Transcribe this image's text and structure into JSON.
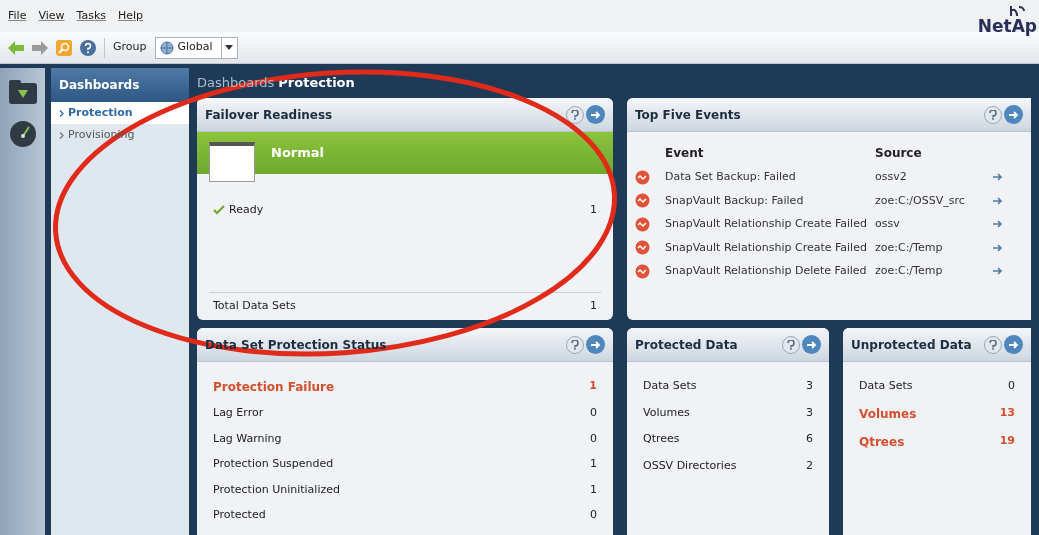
{
  "menu": [
    "File",
    "View",
    "Tasks",
    "Help"
  ],
  "toolbar": {
    "group_label": "Group",
    "group_value": "Global"
  },
  "logo": "NetAp",
  "nav": {
    "title": "Dashboards",
    "items": [
      {
        "label": "Protection",
        "selected": true
      },
      {
        "label": "Provisioning",
        "selected": false
      }
    ]
  },
  "breadcrumb": {
    "section": "Dashboards",
    "page": "Protection"
  },
  "failover": {
    "title": "Failover Readiness",
    "status": "Normal",
    "rows": [
      {
        "label": "Ready",
        "value": "1"
      }
    ],
    "total_label": "Total Data Sets",
    "total_value": "1"
  },
  "events": {
    "title": "Top Five Events",
    "columns": [
      "Event",
      "Source"
    ],
    "rows": [
      {
        "event": "Data Set Backup: Failed",
        "source": "ossv2"
      },
      {
        "event": "SnapVault Backup: Failed",
        "source": "zoe:C:/OSSV_src"
      },
      {
        "event": "SnapVault Relationship Create Failed",
        "source": "ossv"
      },
      {
        "event": "SnapVault Relationship Create Failed",
        "source": "zoe:C:/Temp"
      },
      {
        "event": "SnapVault Relationship Delete Failed",
        "source": "zoe:C:/Temp"
      }
    ]
  },
  "status": {
    "title": "Data Set Protection Status",
    "rows": [
      {
        "label": "Protection Failure",
        "value": "1",
        "alert": true
      },
      {
        "label": "Lag Error",
        "value": "0",
        "alert": false
      },
      {
        "label": "Lag Warning",
        "value": "0",
        "alert": false
      },
      {
        "label": "Protection Suspended",
        "value": "1",
        "alert": false
      },
      {
        "label": "Protection Uninitialized",
        "value": "1",
        "alert": false
      },
      {
        "label": "Protected",
        "value": "0",
        "alert": false
      }
    ]
  },
  "protected": {
    "title": "Protected Data",
    "rows": [
      {
        "label": "Data Sets",
        "value": "3",
        "alert": false
      },
      {
        "label": "Volumes",
        "value": "3",
        "alert": false
      },
      {
        "label": "Qtrees",
        "value": "6",
        "alert": false
      },
      {
        "label": "OSSV Directories",
        "value": "2",
        "alert": false
      }
    ]
  },
  "unprotected": {
    "title": "Unprotected Data",
    "rows": [
      {
        "label": "Data Sets",
        "value": "0",
        "alert": false
      },
      {
        "label": "Volumes",
        "value": "13",
        "alert": true
      },
      {
        "label": "Qtrees",
        "value": "19",
        "alert": true
      }
    ]
  }
}
